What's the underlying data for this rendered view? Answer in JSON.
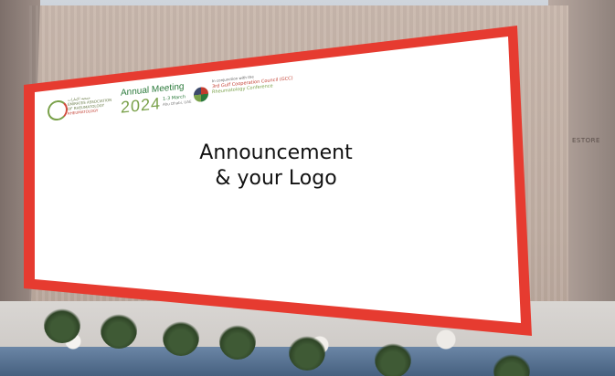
{
  "billboard": {
    "border_color": "#e63b30",
    "association_name_lines": [
      "جمعية الإمارات",
      "EMIRATES ASSOCIATION",
      "OF RHEUMATOLOGY",
      "RHEUMATOLOGY"
    ],
    "meeting_title": "Annual Meeting",
    "meeting_year": "2024",
    "meeting_dates": "1-3 March",
    "meeting_venue": "Abu Dhabi, UAE",
    "gcc_intro": "In conjunction with the",
    "gcc_title": "3rd Gulf Cooperation Council (GCC)",
    "gcc_conference": "Rheumatology Conference",
    "announcement_line1": "Announcement",
    "announcement_line2": "& your Logo"
  },
  "background": {
    "sign_text": "ESTORE"
  }
}
